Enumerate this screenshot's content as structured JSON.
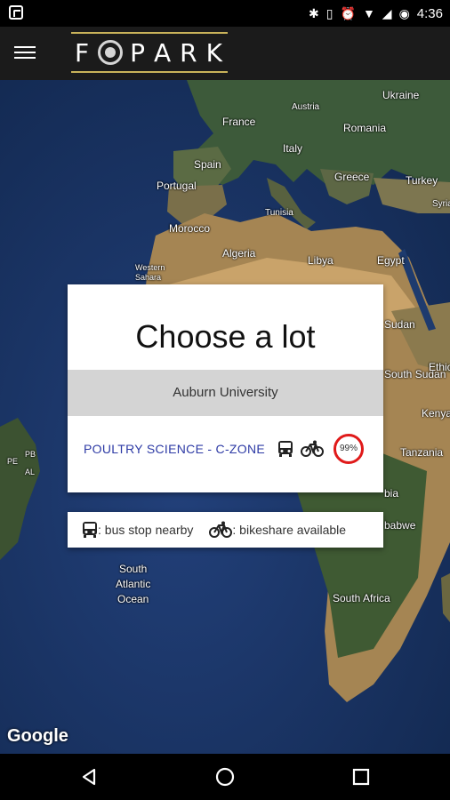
{
  "status_bar": {
    "time": "4:36",
    "icons": [
      "app-notification-icon",
      "bluetooth-icon",
      "vibrate-icon",
      "alarm-icon",
      "wifi-icon",
      "signal-icon",
      "battery-icon"
    ]
  },
  "app_bar": {
    "logo_letters": [
      "F",
      "O",
      "P",
      "A",
      "R",
      "K"
    ],
    "logo_accent_color": "#c9b25a"
  },
  "map": {
    "labels": {
      "ukraine": "Ukraine",
      "austria": "Austria",
      "france": "France",
      "romania": "Romania",
      "italy": "Italy",
      "spain": "Spain",
      "greece": "Greece",
      "turkey": "Turkey",
      "portugal": "Portugal",
      "syria": "Syria",
      "tunisia": "Tunisia",
      "morocco": "Morocco",
      "algeria": "Algeria",
      "libya": "Libya",
      "egypt": "Egypt",
      "western_sahara": "Western Sahara",
      "sudan": "Sudan",
      "south_sudan": "South Sudan",
      "ethiopia": "Ethio",
      "kenya": "Kenya",
      "tanzania": "Tanzania",
      "zambia": "bia",
      "zimbabwe": "babwe",
      "south_africa": "South Africa",
      "pe": "PE",
      "pb": "PB",
      "al": "AL",
      "south_atlantic_ocean": "South\nAtlantic\nOcean"
    },
    "attribution": "Google"
  },
  "dialog": {
    "title": "Choose a lot",
    "university": "Auburn University",
    "lot": {
      "name": "POULTRY SCIENCE - C-ZONE",
      "bus_stop": true,
      "bikeshare": true,
      "availability": "99%",
      "availability_color": "#e01a1a"
    }
  },
  "legend": {
    "bus_text": ": bus stop nearby",
    "bike_text": ": bikeshare available"
  },
  "nav": {
    "buttons": [
      "back-icon",
      "home-icon",
      "recents-icon"
    ]
  }
}
